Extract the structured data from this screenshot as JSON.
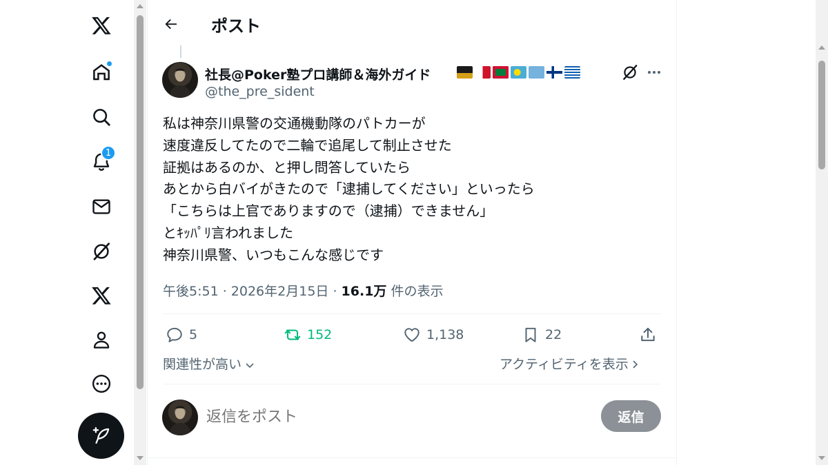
{
  "header": {
    "title": "ポスト",
    "back_icon": "arrow-left-icon"
  },
  "nav": {
    "items": [
      {
        "name": "x-logo-icon"
      },
      {
        "name": "home-icon",
        "has_dot": true
      },
      {
        "name": "search-icon"
      },
      {
        "name": "notifications-icon",
        "badge": "1"
      },
      {
        "name": "messages-icon"
      },
      {
        "name": "grok-icon"
      },
      {
        "name": "premium-x-icon"
      },
      {
        "name": "profile-icon"
      },
      {
        "name": "more-circle-icon"
      }
    ],
    "compose_icon": "compose-feather-icon"
  },
  "post": {
    "author_name": "社長@Poker塾プロ講師＆海外ガイド",
    "author_handle": "@the_pre_sident",
    "name_emojis": [
      "graduation-cap",
      "flag-malta",
      "flag-maldives",
      "flag-palau",
      "flag-micronesia",
      "flag-finland",
      "flag-greece"
    ],
    "text": "私は神奈川県警の交通機動隊のパトカーが\n速度違反してたので二輪で追尾して制止させた\n証拠はあるのか、と押し問答していたら\nあとから白バイがきたので「逮捕してください」といったら\n「こちらは上官でありますので（逮捕）できません」\nとｷｯﾊﾟﾘ言われました\n神奈川県警、いつもこんな感じです",
    "time": "午後5:51 · 2026年2月15日 · ",
    "views_count": "16.1万",
    "views_label": " 件の表示",
    "actions": {
      "replies": "5",
      "reposts": "152",
      "likes": "1,138",
      "bookmarks": "22"
    },
    "relevance_label": "関連性が高い",
    "activity_label": "アクティビティを表示"
  },
  "reply": {
    "placeholder": "返信をポスト",
    "button_label": "返信"
  },
  "colors": {
    "accent": "#1d9bf0",
    "repost_active": "#00ba7c",
    "text_secondary": "#536471",
    "reply_button_disabled": "#8b9196"
  }
}
